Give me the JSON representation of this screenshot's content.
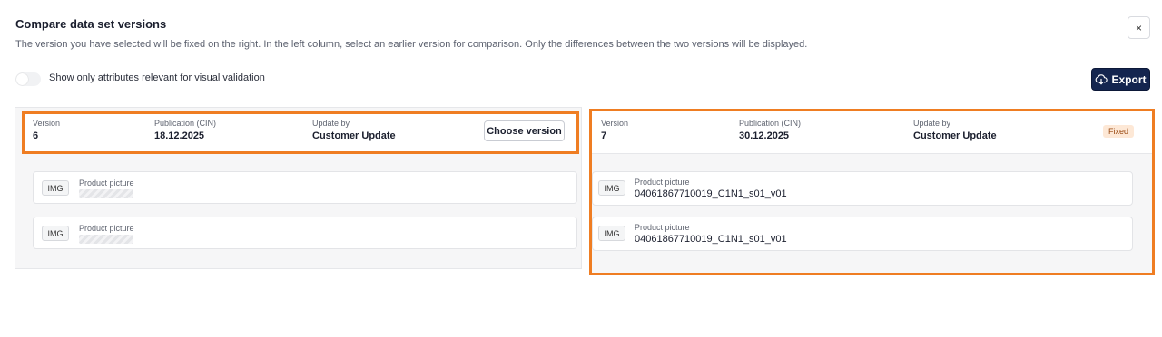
{
  "dialog": {
    "title": "Compare data set versions",
    "subtitle": "The version you have selected will be fixed on the right. In the left column, select an earlier version for comparison. Only the differences between the two versions will be displayed.",
    "close_icon": "×",
    "toggle_label": "Show only attributes relevant for visual validation",
    "toggle_on": false,
    "export_label": "Export"
  },
  "left": {
    "version_label": "Version",
    "version_value": "6",
    "publication_label": "Publication (CIN)",
    "publication_value": "18.12.2025",
    "update_label": "Update by",
    "update_value": "Customer Update",
    "choose_button": "Choose version",
    "attributes": [
      {
        "tag": "IMG",
        "label": "Product picture"
      },
      {
        "tag": "IMG",
        "label": "Product picture"
      }
    ]
  },
  "right": {
    "version_label": "Version",
    "version_value": "7",
    "publication_label": "Publication (CIN)",
    "publication_value": "30.12.2025",
    "update_label": "Update by",
    "update_value": "Customer Update",
    "fixed_badge": "Fixed",
    "attributes": [
      {
        "tag": "IMG",
        "label": "Product picture",
        "value": "04061867710019_C1N1_s01_v01"
      },
      {
        "tag": "IMG",
        "label": "Product picture",
        "value": "04061867710019_C1N1_s01_v01"
      }
    ]
  },
  "colors": {
    "highlight": "#ef7d22",
    "primary_button": "#14254f",
    "fixed_badge_bg": "#fde8d6"
  }
}
